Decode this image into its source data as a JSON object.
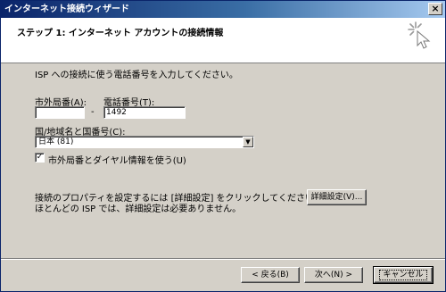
{
  "window": {
    "title": "インターネット接続ウィザード",
    "close_glyph": "×"
  },
  "header": {
    "step_title": "ステップ 1: インターネット アカウントの接続情報",
    "wizard_icon": "sparkle-icon"
  },
  "form": {
    "instruction": "ISP への接続に使う電話番号を入力してください。",
    "area_code_label": "市外局番(A):",
    "area_code_value": "",
    "dash": "-",
    "phone_label": "電話番号(T):",
    "phone_value": "1492",
    "country_label": "国/地域名と国番号(C):",
    "country_value": "日本 (81)",
    "use_area_code_label": "市外局番とダイヤル情報を使う(U)",
    "use_area_code_checked": true,
    "check_glyph": "✓",
    "advanced_text_line1": "接続のプロパティを設定するには [詳細設定] をクリックしてください。",
    "advanced_text_line2": "ほとんどの ISP では、詳細設定は必要ありません。",
    "advanced_button": "詳細設定(V)..."
  },
  "footer": {
    "back_button": "< 戻る(B)",
    "next_button": "次へ(N) >",
    "cancel_button": "キャンセル"
  }
}
